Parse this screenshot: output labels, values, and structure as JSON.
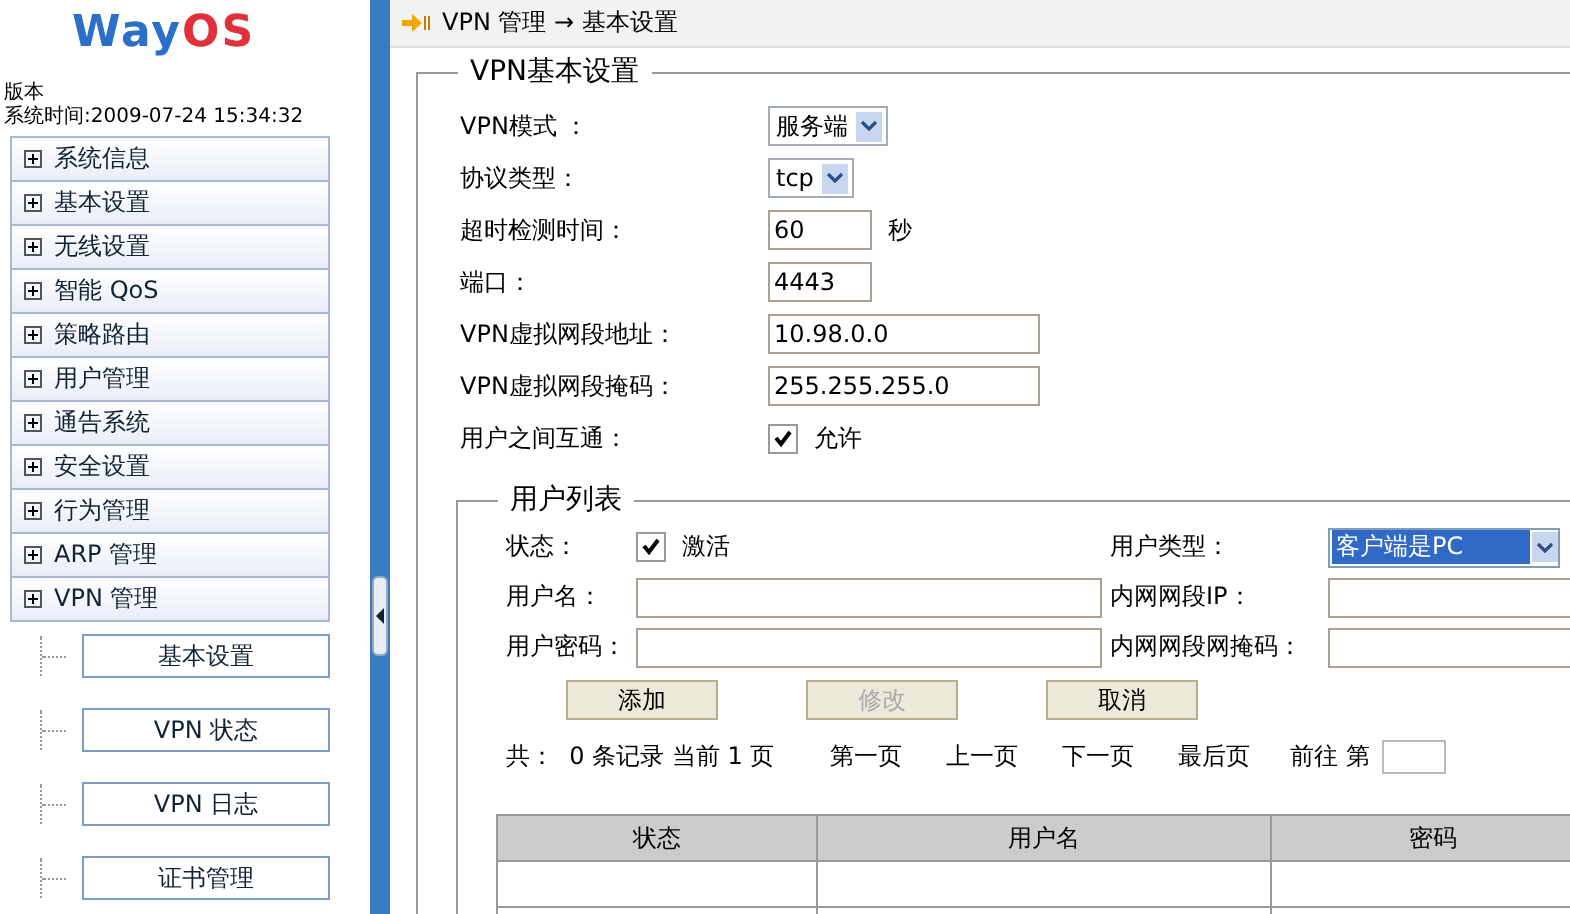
{
  "logo": {
    "part_1": "Way",
    "part_2": "OS"
  },
  "sidebar": {
    "info": [
      "版本",
      "系统时间:2009-07-24 15:34:32"
    ],
    "menu": [
      {
        "label": "系统信息"
      },
      {
        "label": "基本设置"
      },
      {
        "label": "无线设置"
      },
      {
        "label": "智能 QoS"
      },
      {
        "label": "策略路由"
      },
      {
        "label": "用户管理"
      },
      {
        "label": "通告系统"
      },
      {
        "label": "安全设置"
      },
      {
        "label": "行为管理"
      },
      {
        "label": "ARP 管理"
      },
      {
        "label": "VPN 管理",
        "children": [
          {
            "label": "基本设置"
          },
          {
            "label": "VPN 状态"
          },
          {
            "label": "VPN 日志"
          },
          {
            "label": "证书管理"
          }
        ]
      }
    ]
  },
  "breadcrumb": "VPN 管理 → 基本设置",
  "settings": {
    "legend": "VPN基本设置",
    "fields": [
      {
        "kind": "select",
        "label": "VPN模式 ：",
        "value": "服务端"
      },
      {
        "kind": "select",
        "label": "协议类型：",
        "value": "tcp"
      },
      {
        "kind": "short-input",
        "label": "超时检测时间：",
        "value": "60",
        "unit": "秒"
      },
      {
        "kind": "short-input",
        "label": "端口：",
        "value": "4443"
      },
      {
        "kind": "input",
        "label": "VPN虚拟网段地址：",
        "value": "10.98.0.0"
      },
      {
        "kind": "input",
        "label": "VPN虚拟网段掩码：",
        "value": "255.255.255.0"
      },
      {
        "kind": "checkbox",
        "label": "用户之间互通：",
        "text": "允许",
        "checked": true
      }
    ]
  },
  "user_list": {
    "legend": "用户列表",
    "status": {
      "label": "状态：",
      "text": "激活",
      "checked": true
    },
    "user_type": {
      "label": "用户类型：",
      "value": "客户端是PC"
    },
    "fields": [
      {
        "label": "用户名："
      },
      {
        "label": "内网网段IP："
      },
      {
        "label": "用户密码："
      },
      {
        "label": "内网网段网掩码："
      }
    ],
    "buttons": [
      {
        "label": "添加",
        "disabled": false
      },
      {
        "label": "修改",
        "disabled": true
      },
      {
        "label": "取消",
        "disabled": false
      }
    ],
    "pager": {
      "summary": "共：  0 条记录 当前 1 页",
      "links": [
        "第一页",
        "上一页",
        "下一页",
        "最后页"
      ],
      "goto": "前往 第"
    },
    "table": {
      "columns": [
        "状态",
        "用户名",
        "密码"
      ]
    }
  }
}
